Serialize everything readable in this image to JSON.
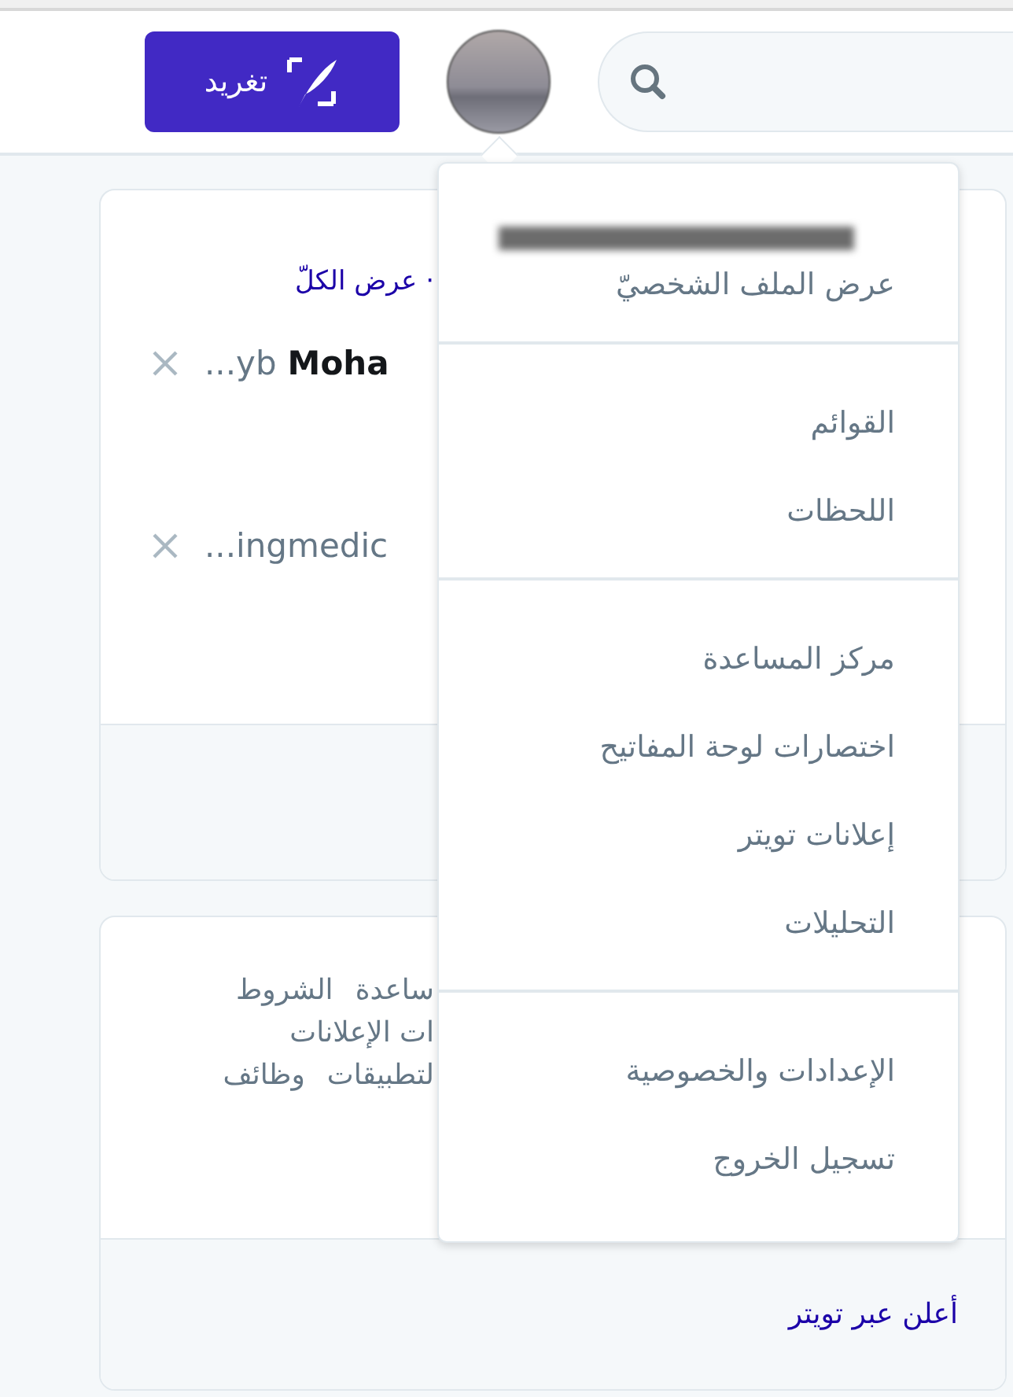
{
  "header": {
    "tweet_button": "تغريد"
  },
  "who_to_follow": {
    "view_all": "· عرض الكلّ",
    "suggestions": [
      {
        "handle": "...yb",
        "name": "Moha"
      },
      {
        "handle": "...ingmedic"
      }
    ]
  },
  "footer_links": [
    [
      "ساعدة",
      "الشروط"
    ],
    [
      "ات الإعلانات"
    ],
    [
      "لتطبيقات",
      "وظائف"
    ]
  ],
  "advertise_link": "أعلن عبر تويتر",
  "menu": {
    "profile_link": "عرض الملف الشخصيّ",
    "sections": [
      [
        "القوائم",
        "اللحظات"
      ],
      [
        "مركز المساعدة",
        "اختصارات لوحة المفاتيح",
        "إعلانات تويتر",
        "التحليلات"
      ],
      [
        "الإعدادات والخصوصية",
        "تسجيل الخروج"
      ]
    ]
  }
}
